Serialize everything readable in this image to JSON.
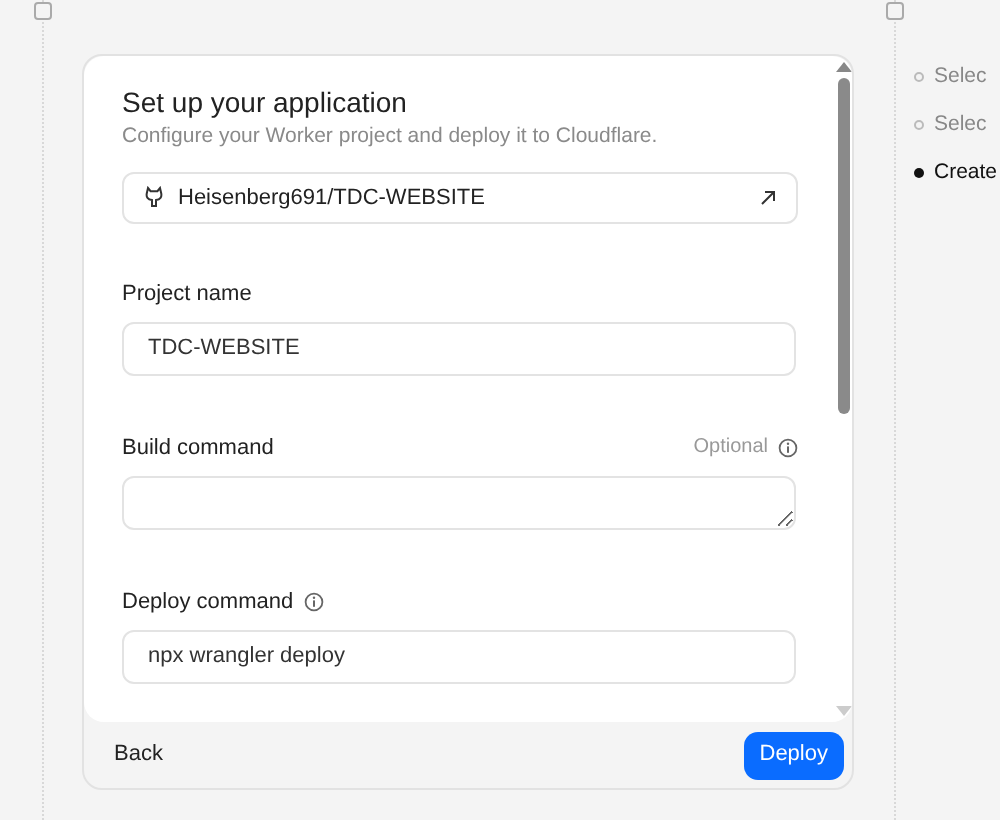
{
  "dialog": {
    "title": "Set up your application",
    "subtitle": "Configure your Worker project and deploy it to Cloudflare.",
    "repository": {
      "label": "Heisenberg691/TDC-WEBSITE"
    },
    "fields": [
      {
        "kind": "input",
        "label": "Project name",
        "value": "TDC-WEBSITE",
        "info": false
      },
      {
        "kind": "textarea",
        "label": "Build command",
        "hint": "Optional",
        "info": true
      },
      {
        "kind": "input",
        "label": "Deploy command",
        "value": "npx wrangler deploy",
        "info": true
      }
    ],
    "back_button": "Back",
    "deploy_button": "Deploy"
  },
  "steps": [
    {
      "label": "Selec",
      "selected": false
    },
    {
      "label": "Selec",
      "selected": false
    },
    {
      "label": "Create",
      "selected": true
    }
  ]
}
